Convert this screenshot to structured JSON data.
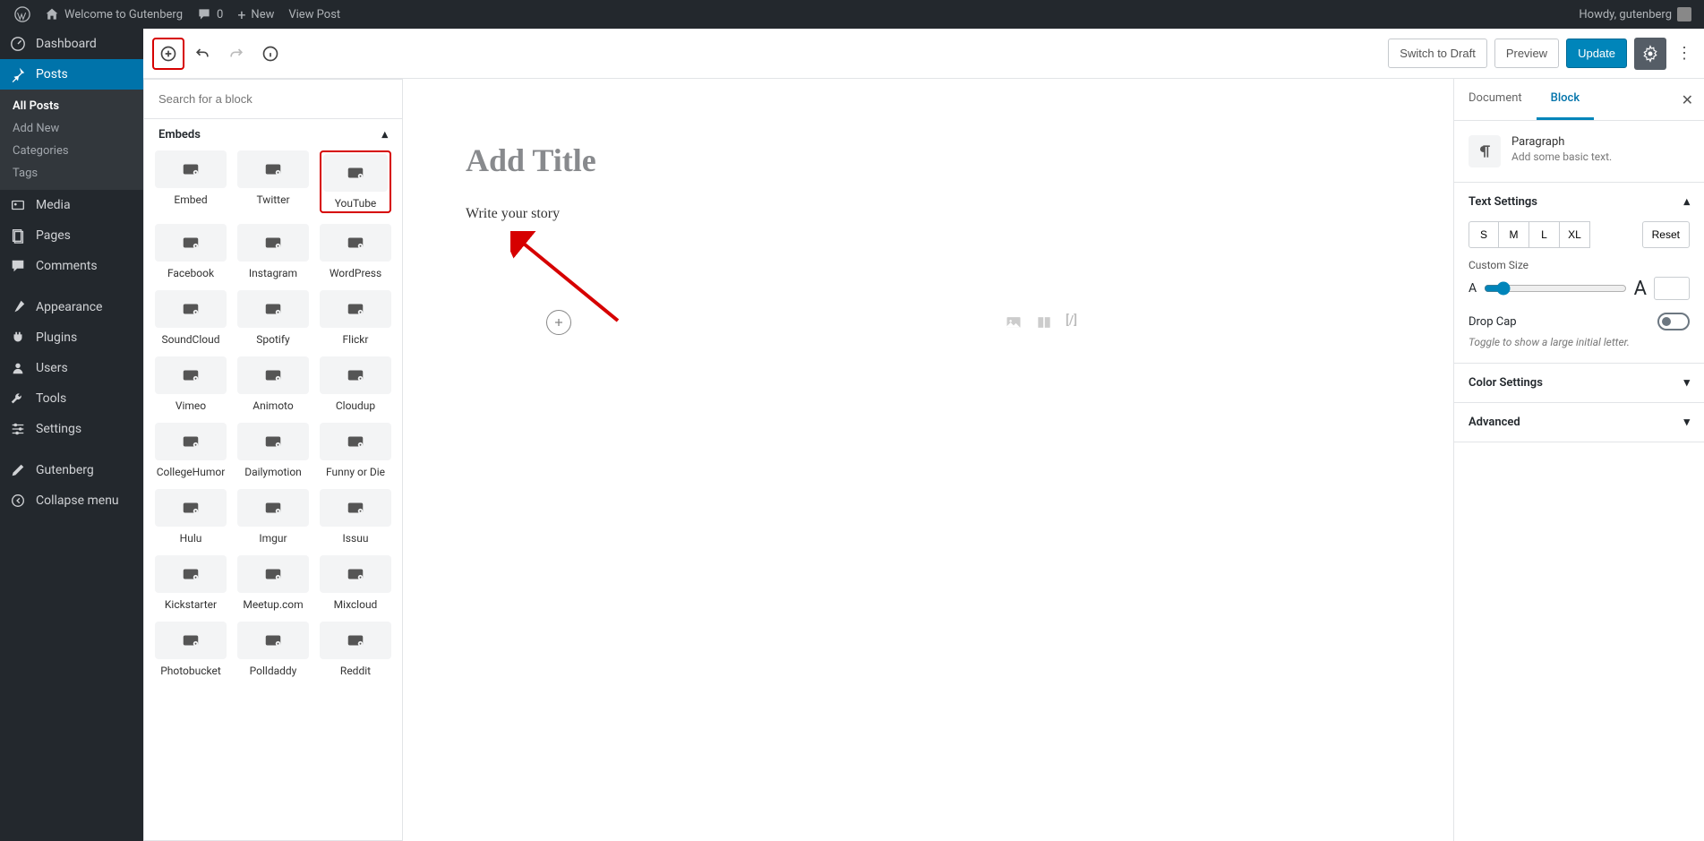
{
  "topbar": {
    "site_name": "Welcome to Gutenberg",
    "comments": "0",
    "new": "New",
    "view_post": "View Post",
    "howdy": "Howdy, gutenberg"
  },
  "sidebar": {
    "dashboard": "Dashboard",
    "posts": "Posts",
    "posts_sub": [
      "All Posts",
      "Add New",
      "Categories",
      "Tags"
    ],
    "media": "Media",
    "pages": "Pages",
    "comments": "Comments",
    "appearance": "Appearance",
    "plugins": "Plugins",
    "users": "Users",
    "tools": "Tools",
    "settings": "Settings",
    "gutenberg": "Gutenberg",
    "collapse": "Collapse menu"
  },
  "editor": {
    "switch_to_draft": "Switch to Draft",
    "preview": "Preview",
    "update": "Update",
    "title_placeholder": "Add Title",
    "story_placeholder": "Write your story",
    "shortcode_hint": "[/]"
  },
  "inserter": {
    "search_placeholder": "Search for a block",
    "section": "Embeds",
    "blocks": [
      "Embed",
      "Twitter",
      "YouTube",
      "Facebook",
      "Instagram",
      "WordPress",
      "SoundCloud",
      "Spotify",
      "Flickr",
      "Vimeo",
      "Animoto",
      "Cloudup",
      "CollegeHumor",
      "Dailymotion",
      "Funny or Die",
      "Hulu",
      "Imgur",
      "Issuu",
      "Kickstarter",
      "Meetup.com",
      "Mixcloud",
      "Photobucket",
      "Polldaddy",
      "Reddit"
    ]
  },
  "inspector": {
    "tab_document": "Document",
    "tab_block": "Block",
    "block_title": "Paragraph",
    "block_desc": "Add some basic text.",
    "text_settings": "Text Settings",
    "sizes": [
      "S",
      "M",
      "L",
      "XL"
    ],
    "reset": "Reset",
    "custom_size": "Custom Size",
    "drop_cap": "Drop Cap",
    "drop_cap_hint": "Toggle to show a large initial letter.",
    "color_settings": "Color Settings",
    "advanced": "Advanced"
  }
}
